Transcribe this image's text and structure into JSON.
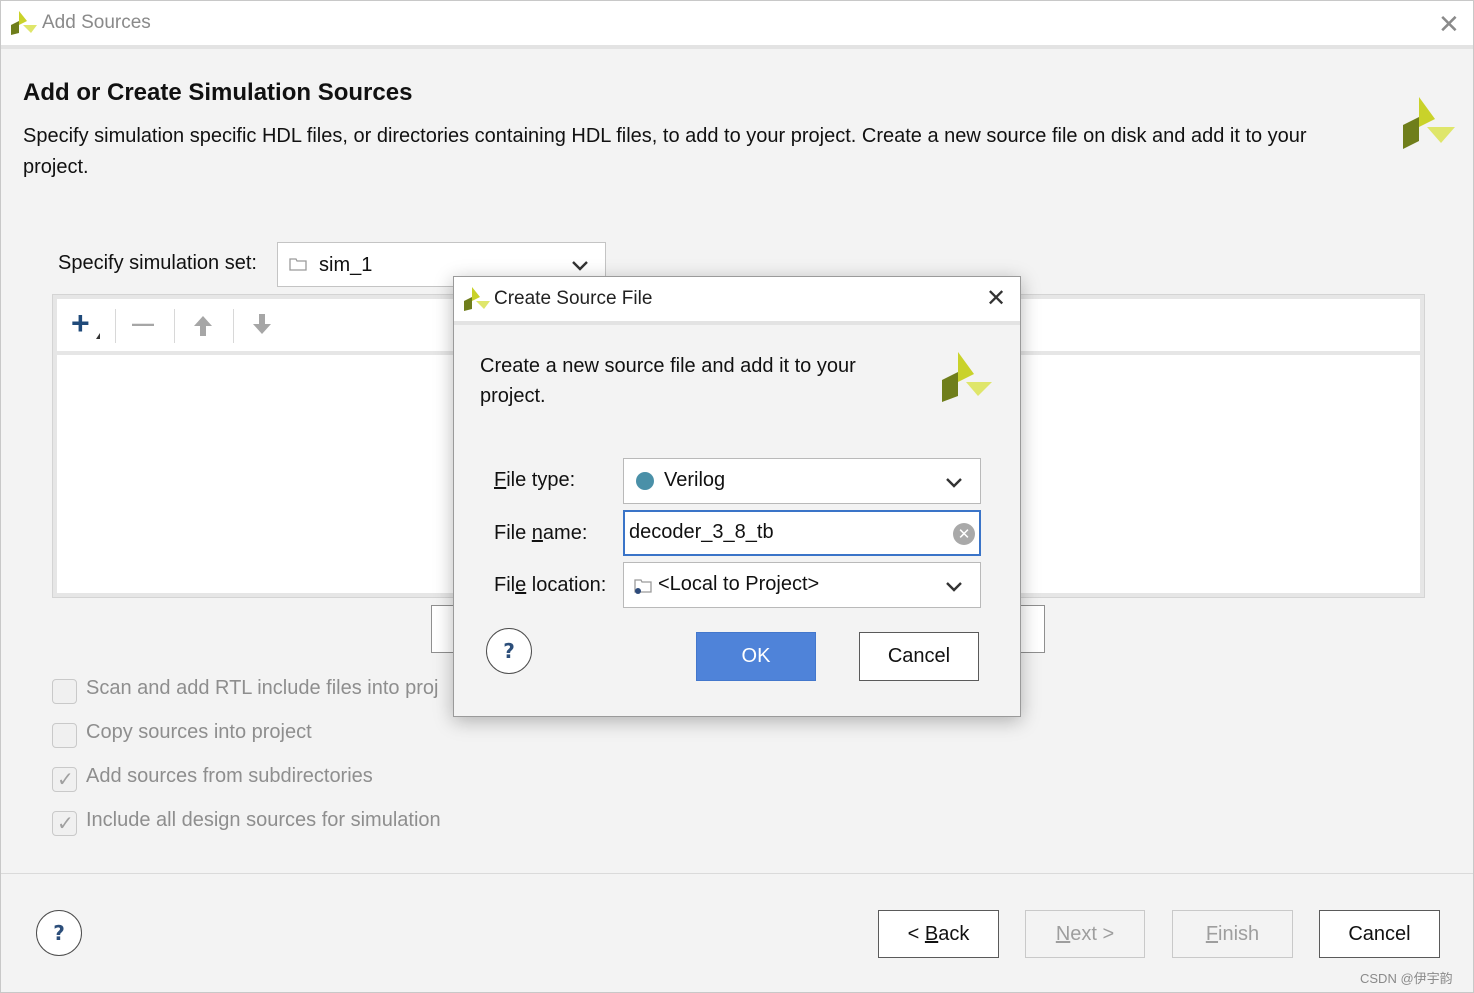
{
  "window": {
    "title": "Add Sources",
    "close_glyph": "✕",
    "heading": "Add or Create Simulation Sources",
    "description": "Specify simulation specific HDL files, or directories containing HDL files, to add to your project. Create a new source file on disk and add it to your project."
  },
  "sim_set": {
    "label": "Specify simulation set:",
    "value": "sim_1",
    "icon": "folder-icon"
  },
  "toolbar": {
    "add_glyph": "+",
    "remove_glyph": "—",
    "up_glyph": "🡅",
    "down_glyph": "🡇"
  },
  "options": [
    {
      "label": "Scan and add RTL include files into proj",
      "checked": false
    },
    {
      "label": "Copy sources into project",
      "checked": false
    },
    {
      "label": "Add sources from subdirectories",
      "checked": true
    },
    {
      "label": "Include all design sources for simulation",
      "checked": true
    }
  ],
  "footer": {
    "help_glyph": "?",
    "back": {
      "pre": "< ",
      "mnemonic": "B",
      "rest": "ack"
    },
    "next": {
      "mnemonic": "N",
      "rest": "ext >"
    },
    "finish": {
      "mnemonic": "F",
      "rest": "inish"
    },
    "cancel": "Cancel"
  },
  "dialog": {
    "title": "Create Source File",
    "close_glyph": "✕",
    "description": "Create a new source file and add it to your project.",
    "file_type": {
      "mnemonic": "F",
      "label_rest": "ile type:",
      "value": "Verilog",
      "color": "#4a90a8"
    },
    "file_name": {
      "pre": "File ",
      "mnemonic": "n",
      "label_rest": "ame:",
      "value": "decoder_3_8_tb"
    },
    "file_location": {
      "pre": "Fil",
      "mnemonic": "e",
      "label_rest": " location:",
      "value": "<Local to Project>"
    },
    "help_glyph": "?",
    "ok": "OK",
    "cancel": "Cancel"
  },
  "watermark": "CSDN @伊宇韵",
  "colors": {
    "accent": "#4f83d9",
    "focus": "#3a74c8",
    "logo_yellow": "#d8df2e",
    "logo_green": "#6f7e1b"
  }
}
